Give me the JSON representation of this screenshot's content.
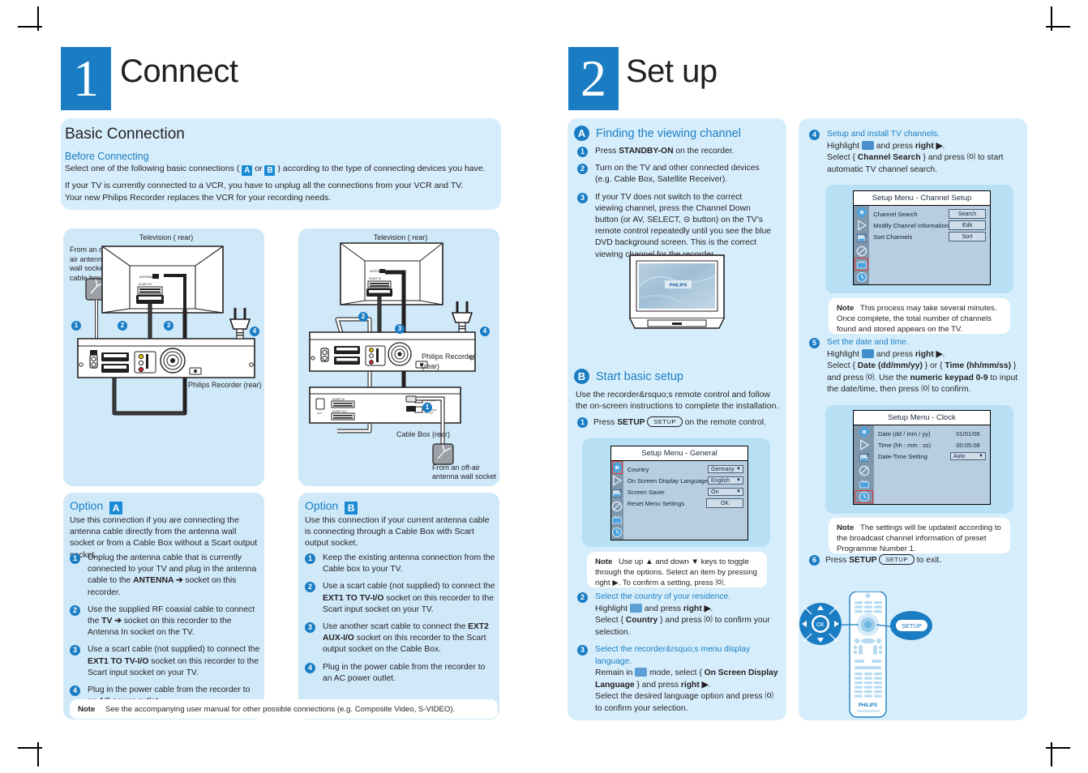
{
  "crop_marks": true,
  "left_page": {
    "step_number": "1",
    "step_title": "Connect",
    "basic": {
      "heading": "Basic Connection",
      "subheading": "Before Connecting",
      "line1_a": "Select one of the following basic connections ( ",
      "badge_a": "A",
      "line1_b": " or ",
      "badge_b": "B",
      "line1_c": " ) according to the type of connecting devices you have.",
      "para2_l1": "If your TV is currently connected to a VCR, you have to unplug all the connections from your VCR and TV.",
      "para2_l2": "Your new Philips Recorder replaces the VCR for your recording needs."
    },
    "diagram_a": {
      "tv_label": "Television ( rear)",
      "antenna_label": "From an off-\nair antenna\nwall socket or\ncable box",
      "recorder_label": "Philips Recorder (rear)",
      "callouts": [
        "1",
        "2",
        "3",
        "4"
      ],
      "tv_port_labels": [
        "ANTENNA IN",
        "SCART IN"
      ]
    },
    "diagram_b": {
      "tv_label": "Television ( rear)",
      "recorder_label_l1": "Philips Recorder",
      "recorder_label_l2": "(rear)",
      "cablebox_label": "Cable Box (rear)",
      "antenna_label_l1": "From an off-air",
      "antenna_label_l2": "antenna wall socket",
      "callouts": [
        "1",
        "2",
        "3",
        "4"
      ],
      "cablebox_ports": [
        "SCART IN",
        "SCART OUT"
      ]
    },
    "option_a": {
      "title": "Option",
      "badge": "A",
      "intro": "Use this connection if you are connecting the antenna cable directly from the antenna wall socket or from a Cable Box without a Scart output socket.",
      "steps": [
        {
          "n": "1",
          "html": "Unplug the antenna cable that is currently connected to your TV and plug in the antenna cable to the <b>ANTENNA &#10132;</b> socket on this recorder."
        },
        {
          "n": "2",
          "html": "Use the supplied RF coaxial cable to connect the <b>TV &#10132;</b> socket on this recorder to the Antenna In socket on the TV."
        },
        {
          "n": "3",
          "html": "Use a scart cable (not supplied) to connect the <b>EXT1 TO TV-I/O</b> socket on this recorder to the Scart input socket on your TV."
        },
        {
          "n": "4",
          "html": "Plug in the power cable from the recorder to an AC power outlet."
        }
      ]
    },
    "option_b": {
      "title": "Option",
      "badge": "B",
      "intro": "Use this connection if your current antenna cable is connecting through a Cable Box with Scart output socket.",
      "steps": [
        {
          "n": "1",
          "html": "Keep the existing antenna connection from the Cable box to your TV."
        },
        {
          "n": "2",
          "html": "Use a scart cable (not supplied) to connect the <b>EXT1 TO TV-I/O</b> socket on this recorder to the Scart input socket on your TV."
        },
        {
          "n": "3",
          "html": "Use another scart cable to connect the <b>EXT2 AUX-I/O</b> socket on this recorder to the Scart output socket on the Cable Box."
        },
        {
          "n": "4",
          "html": "Plug in the power cable from the recorder to an AC power outlet."
        }
      ]
    },
    "bottom_note": {
      "label": "Note",
      "text": "See the accompanying user manual for other possible connections (e.g. Composite Video, S-VIDEO)."
    }
  },
  "right_page": {
    "step_number": "2",
    "step_title": "Set up",
    "section_a": {
      "badge": "A",
      "title": "Finding the viewing channel",
      "steps": [
        {
          "n": "1",
          "html": "Press <b>STANDBY-ON</b> on the recorder."
        },
        {
          "n": "2",
          "html": "Turn on the TV and other connected devices (e.g. Cable Box, Satellite Receiver)."
        },
        {
          "n": "3",
          "html": "If your TV does not switch to the correct viewing channel, press the Channel Down button (or AV, SELECT, &#8861; button) on the TV&rsquo;s remote control repeatedly until you see the blue DVD background screen.  This is the correct viewing channel for the recorder."
        }
      ],
      "tv_logo": "PHILIPS"
    },
    "section_b": {
      "badge": "B",
      "title": "Start basic setup",
      "intro": "Use the recorder&rsquo;s remote control and follow the on-screen instructions to complete the installation.",
      "step1_pre": "Press ",
      "step1_bold": "SETUP",
      "step1_pill": "SETUP",
      "step1_post": " on the remote control.",
      "menu_general": {
        "title": "Setup Menu - General",
        "rows": [
          {
            "label": "Country",
            "value": "Germany",
            "type": "dropdown"
          },
          {
            "label": "On Screen Display Language",
            "value": "English",
            "type": "dropdown"
          },
          {
            "label": "Screen Saver",
            "value": "On",
            "type": "dropdown"
          },
          {
            "label": "Reset Menu Settings",
            "value": "OK",
            "type": "button"
          }
        ],
        "rail_icons": [
          "gear-icon",
          "play-icon",
          "record-icon",
          "disc-icon",
          "tv-icon",
          "clock-icon"
        ],
        "selected_rail_index": 0
      },
      "note": {
        "label": "Note",
        "text": "Use up ▲ and down ▼ keys to toggle through the options. Select an item by pressing right ▶.  To confirm a setting, press ⒪."
      },
      "step2": {
        "n": "2",
        "heading": "Select the country of your residence.",
        "l1_pre": "Highlight ",
        "l1_post": " and press ",
        "l1_bold": "right ▶",
        "l1_end": ".",
        "l2": "Select { <b>Country</b> } and press ⒪ to confirm your selection."
      },
      "step3": {
        "n": "3",
        "heading": "Select the recorder&rsquo;s menu display language.",
        "l1_pre": "Remain in ",
        "l1_post": " mode, select { <b>On Screen Display Language</b> } and press <b>right ▶</b>.",
        "l2": "Select the desired language option and press ⒪ to confirm your selection."
      }
    },
    "section_right": {
      "step4": {
        "n": "4",
        "heading": "Setup and install TV channels.",
        "l1_pre": "Highlight ",
        "l1_post": " and press ",
        "l1_bold": "right ▶",
        "l1_end": ".",
        "l2": "Select { <b>Channel Search</b> } and press ⒪ to start automatic TV channel search."
      },
      "menu_channel": {
        "title": "Setup Menu - Channel Setup",
        "rows": [
          {
            "label": "Channel Search",
            "value": "Search",
            "type": "button"
          },
          {
            "label": "Modify Channel Information",
            "value": "Edit",
            "type": "button"
          },
          {
            "label": "Sort Channels",
            "value": "Sort",
            "type": "button"
          }
        ],
        "rail_icons": [
          "gear-icon",
          "play-icon",
          "record-icon",
          "disc-icon",
          "tv-icon",
          "clock-icon"
        ],
        "selected_rail_index": 4
      },
      "note4": {
        "label": "Note",
        "text": "This process may take several minutes. Once complete, the total number of channels found and stored appears on the TV."
      },
      "step5": {
        "n": "5",
        "heading": "Set the date and time.",
        "l1_pre": "Highlight ",
        "l1_post": " and press ",
        "l1_bold": "right ▶",
        "l1_end": ".",
        "l2": "Select { <b>Date (dd/mm/yy)</b> } or { <b>Time (hh/mm/ss)</b> } and press ⒪.  Use the <b>numeric keypad 0-9</b> to input the date/time, then press ⒪ to confirm."
      },
      "menu_clock": {
        "title": "Setup Menu - Clock",
        "rows": [
          {
            "label": "Date (dd / mm / yy)",
            "value": "01/01/06",
            "type": "plain"
          },
          {
            "label": "Time (hh : mm : ss)",
            "value": "00:05:08",
            "type": "plain"
          },
          {
            "label": "Date-Time Setting",
            "value": "Auto",
            "type": "dropdown"
          }
        ],
        "rail_icons": [
          "gear-icon",
          "play-icon",
          "record-icon",
          "disc-icon",
          "tv-icon",
          "clock-icon"
        ],
        "selected_rail_index": 5
      },
      "note5": {
        "label": "Note",
        "text": "The settings will be updated according to the broadcast channel information of preset Programme Number 1."
      },
      "step6": {
        "n": "6",
        "pre": "Press ",
        "bold": "SETUP",
        "pill": "SETUP",
        "post": " to exit."
      },
      "remote": {
        "ok_label": "OK",
        "setup_label": "SETUP",
        "brand": "PHILIPS"
      }
    }
  },
  "colors": {
    "brand_blue": "#1a7dc4",
    "panel_bg": "#d6eefb",
    "panel_inner": "#cfe9f9",
    "badge_blue": "#1a8ad4",
    "menu_rail": "#7f97ad",
    "menu_body": "#b9cde0",
    "select_red": "#e03a3a"
  }
}
